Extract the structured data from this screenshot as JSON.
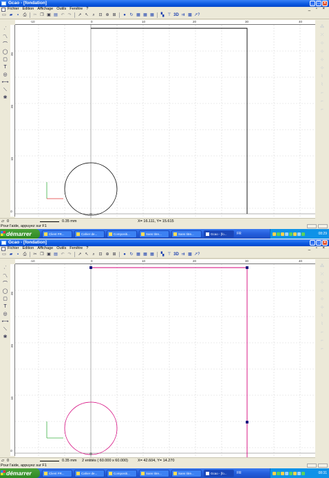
{
  "app": {
    "title": "Gcao - [fondation]"
  },
  "menu": {
    "items": [
      "Fichier",
      "Edition",
      "Affichage",
      "Outils",
      "Fenêtre",
      "?"
    ]
  },
  "ruler": {
    "h_ticks": [
      "-10",
      "0",
      "10",
      "20",
      "30",
      "40"
    ],
    "v_ticks": [
      "20",
      "10",
      "0"
    ]
  },
  "shot_a": {
    "status": {
      "layer": "0",
      "line_width": "0.35 mm",
      "selection": "",
      "coords": "X=   16.111, Y=   15.615"
    },
    "help": "Pour l'aide, appuyez sur F1",
    "drawing": {
      "shape_color": "#000000",
      "rectangle_color": "#000000",
      "handles": false
    }
  },
  "shot_b": {
    "status": {
      "layer": "0",
      "line_width": "0.35 mm",
      "selection": "2 entités ( 60.000 x  60.000)",
      "coords": "X=   42.604, Y=   14.270"
    },
    "help": "Pour l'aide, appuyez sur F1",
    "drawing": {
      "shape_color": "#d4007a",
      "rectangle_color": "#d4007a",
      "handles": true
    }
  },
  "taskbar": {
    "start": "démarrer",
    "tasks_a": [
      "Client FR...",
      "Cahier de...",
      "Compositi...",
      "Sans titre...",
      "Sans titre...",
      "Gcao - [fo..."
    ],
    "tasks_b": [
      "Client FR...",
      "Cahier de...",
      "Compositi...",
      "Sans titre...",
      "Sans titre...",
      "Gcao - [fo..."
    ],
    "lang": "FR",
    "clock_a": "08:29",
    "clock_b": "08:31"
  },
  "colors": {
    "accent": "#245edc",
    "axis": "#3cb043",
    "axis_y": "#e03030"
  }
}
